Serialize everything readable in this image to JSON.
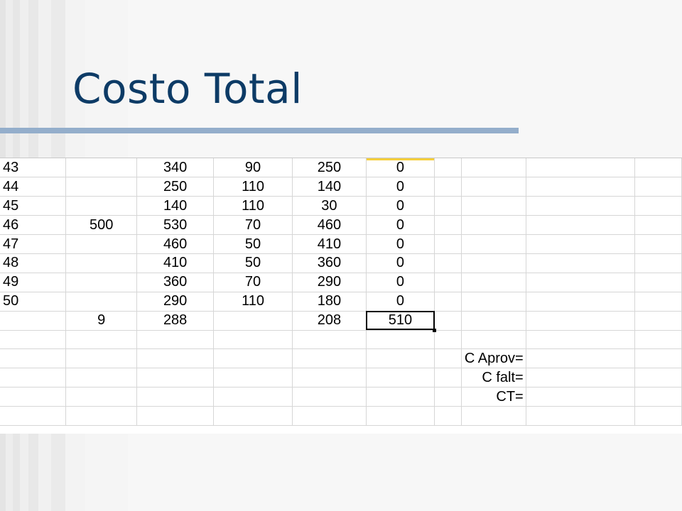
{
  "slide": {
    "title": "Costo Total"
  },
  "sheet": {
    "rows": [
      [
        "43",
        "",
        "340",
        "90",
        "250",
        "0",
        "",
        "",
        "",
        ""
      ],
      [
        "44",
        "",
        "250",
        "110",
        "140",
        "0",
        "",
        "",
        "",
        ""
      ],
      [
        "45",
        "",
        "140",
        "110",
        "30",
        "0",
        "",
        "",
        "",
        ""
      ],
      [
        "46",
        "500",
        "530",
        "70",
        "460",
        "0",
        "",
        "",
        "",
        ""
      ],
      [
        "47",
        "",
        "460",
        "50",
        "410",
        "0",
        "",
        "",
        "",
        ""
      ],
      [
        "48",
        "",
        "410",
        "50",
        "360",
        "0",
        "",
        "",
        "",
        ""
      ],
      [
        "49",
        "",
        "360",
        "70",
        "290",
        "0",
        "",
        "",
        "",
        ""
      ],
      [
        "50",
        "",
        "290",
        "110",
        "180",
        "0",
        "",
        "",
        "",
        ""
      ],
      [
        "",
        "9",
        "288",
        "",
        "208",
        "510",
        "",
        "",
        "",
        ""
      ],
      [
        "",
        "",
        "",
        "",
        "",
        "",
        "",
        "",
        "",
        ""
      ],
      [
        "",
        "",
        "",
        "",
        "",
        "",
        "C Aprov=",
        "",
        "",
        ""
      ],
      [
        "",
        "",
        "",
        "",
        "",
        "",
        "C falt=",
        "",
        "",
        ""
      ],
      [
        "",
        "",
        "",
        "",
        "",
        "",
        "CT=",
        "",
        "",
        ""
      ],
      [
        "",
        "",
        "",
        "",
        "",
        "",
        "",
        "",
        "",
        ""
      ]
    ],
    "selected_cell": "510"
  },
  "colors": {
    "title": "#0d3b66",
    "title_rule": "#94aecb",
    "active_column_marker": "#f5cf3c"
  }
}
